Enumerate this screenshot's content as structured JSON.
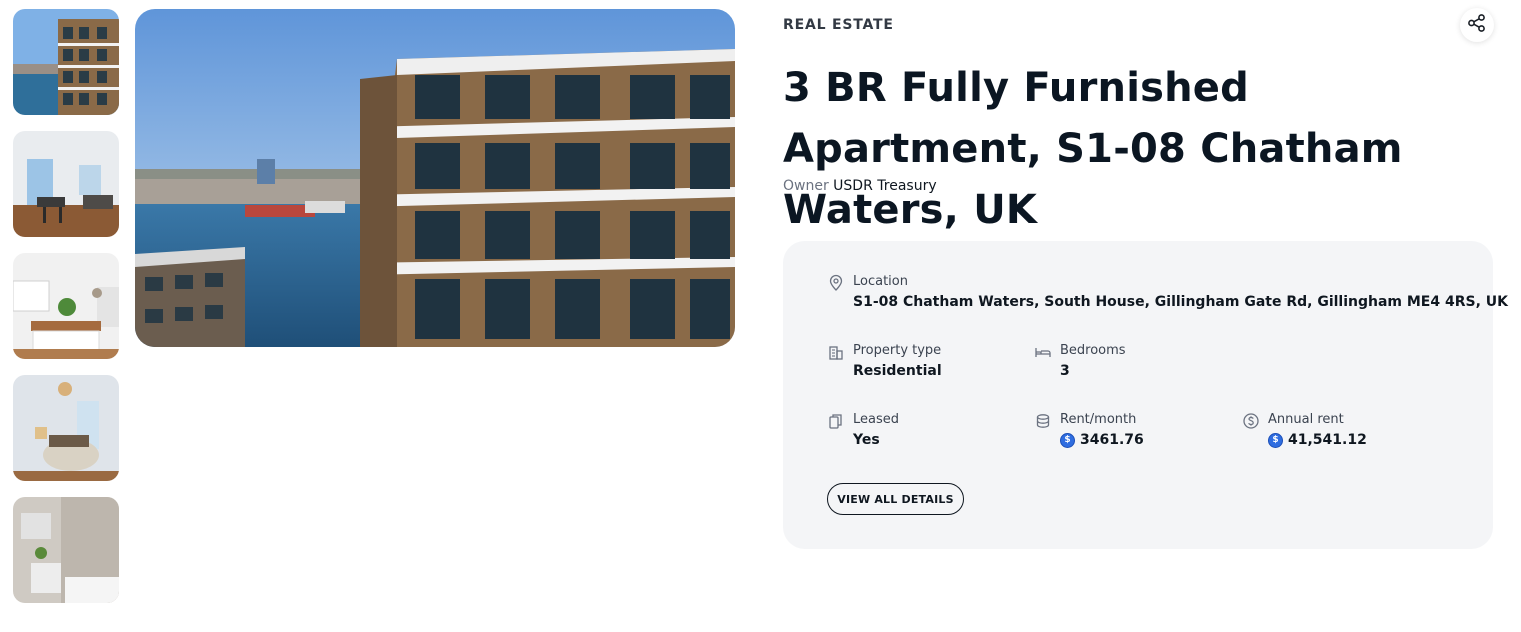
{
  "listing": {
    "category": "REAL ESTATE",
    "title": "3 BR Fully Furnished Apartment, S1-08 Chatham Waters, UK",
    "owner_label": "Owner",
    "owner_name": "USDR Treasury"
  },
  "details": {
    "location": {
      "label": "Location",
      "value": "S1-08 Chatham Waters, South House, Gillingham Gate Rd, Gillingham ME4 4RS, UK",
      "icon": "location-pin-icon"
    },
    "property_type": {
      "label": "Property type",
      "value": "Residential",
      "icon": "building-icon"
    },
    "bedrooms": {
      "label": "Bedrooms",
      "value": "3",
      "icon": "bed-icon"
    },
    "leased": {
      "label": "Leased",
      "value": "Yes",
      "icon": "documents-icon"
    },
    "rent_month": {
      "label": "Rent/month",
      "value": "3461.76",
      "icon": "coins-icon"
    },
    "annual_rent": {
      "label": "Annual rent",
      "value": "41,541.12",
      "icon": "dollar-circle-icon"
    }
  },
  "buttons": {
    "view_all": "VIEW ALL DETAILS"
  },
  "gallery": {
    "thumbnails": [
      "building-exterior",
      "living-room",
      "kitchen",
      "bedroom",
      "bathroom"
    ]
  },
  "colors": {
    "card_bg": "#f4f5f7",
    "coin": "#2f6de0",
    "title": "#0b1622"
  }
}
